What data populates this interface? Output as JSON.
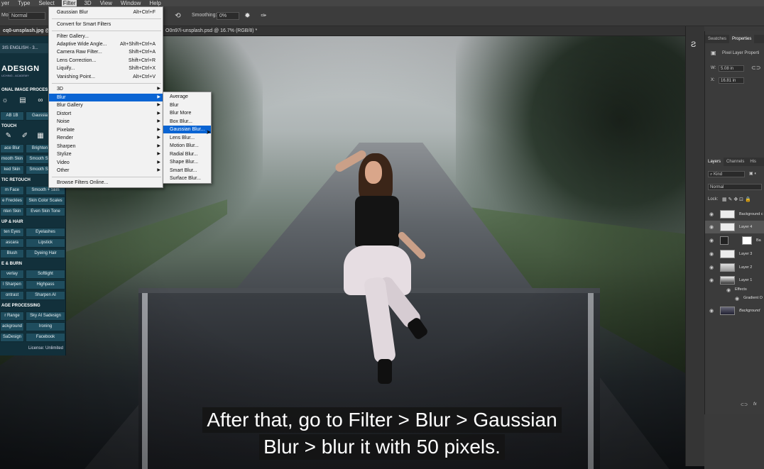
{
  "menubar": {
    "items": [
      "yer",
      "Type",
      "Select",
      "Filter",
      "3D",
      "View",
      "Window",
      "Help"
    ],
    "active": "Filter"
  },
  "options": {
    "mode_label": "Mode:",
    "mode_value": "Normal",
    "smoothing_label": "Smoothing:",
    "smoothing_value": "0%"
  },
  "tabs": {
    "left_doc": "cq0-unsplash.jpg @",
    "right_doc": "O0n97i-unsplash.psd @ 16.7% (RGB/8) *"
  },
  "filter_menu": {
    "top": [
      {
        "label": "Gaussian Blur",
        "shortcut": "Alt+Ctrl+F"
      },
      {
        "label": "Convert for Smart Filters",
        "shortcut": ""
      }
    ],
    "group2": [
      {
        "label": "Filter Gallery...",
        "shortcut": ""
      },
      {
        "label": "Adaptive Wide Angle...",
        "shortcut": "Alt+Shift+Ctrl+A"
      },
      {
        "label": "Camera Raw Filter...",
        "shortcut": "Shift+Ctrl+A"
      },
      {
        "label": "Lens Correction...",
        "shortcut": "Shift+Ctrl+R"
      },
      {
        "label": "Liquify...",
        "shortcut": "Shift+Ctrl+X"
      },
      {
        "label": "Vanishing Point...",
        "shortcut": "Alt+Ctrl+V"
      }
    ],
    "submenus": [
      "3D",
      "Blur",
      "Blur Gallery",
      "Distort",
      "Noise",
      "Pixelate",
      "Render",
      "Sharpen",
      "Stylize",
      "Video",
      "Other"
    ],
    "highlighted": "Blur",
    "browse": "Browse Filters Online..."
  },
  "blur_menu": {
    "items": [
      "Average",
      "Blur",
      "Blur More",
      "Box Blur...",
      "Gaussian Blur...",
      "Lens Blur...",
      "Motion Blur...",
      "Radial Blur...",
      "Shape Blur...",
      "Smart Blur...",
      "Surface Blur..."
    ],
    "highlighted": "Gaussian Blur..."
  },
  "plugin": {
    "tab": "3IS ENGLISH - 3...",
    "brand": "ADESIGN",
    "brand_sub": "UCHING - ACADEMY",
    "sections": {
      "s1": "ONAL IMAGE PROCES",
      "s2": "TOUCH",
      "s3": "TIC RETOUCH",
      "s4": "UP & HAIR",
      "s5": "E & BURN",
      "s6": "AGE PROCESSING"
    },
    "buttons": {
      "b1": "AB 1B",
      "b2": "Gaussia",
      "b3": "ace Blur",
      "b4": "Brighten",
      "b5": "mooth Skin",
      "b6": "Smooth Sk",
      "b7": "ked Skin",
      "b8": "Smooth Sk",
      "b9": "m Face",
      "b10": "Smooth + Slim",
      "b11": "e Freckles",
      "b12": "Skin Color Scales",
      "b13": "nten Skin",
      "b14": "Even Skin Tone",
      "b15": "ten Eyes",
      "b16": "Eyelashes",
      "b17": "ascara",
      "b18": "Lipstick",
      "b19": "Blush",
      "b20": "Dyeing Hair",
      "b21": "verlay",
      "b22": "Softlight",
      "b23": "l Sharpen",
      "b24": "Highpass",
      "b25": "ontrast",
      "b26": "Sharpen AI",
      "b27": "r Range",
      "b28": "Sky AI Sadesign",
      "b29": "ackground",
      "b30": "Ironing",
      "b31": "SaDesign",
      "b32": "Facebook"
    },
    "license": "License: Unlimited"
  },
  "properties": {
    "tab1": "Swatches",
    "tab2": "Properties",
    "type": "Pixel Layer Properti",
    "w_label": "W:",
    "w_value": "5.08 in",
    "x_label": "X:",
    "x_value": "16.81 in"
  },
  "layers": {
    "tab1": "Layers",
    "tab2": "Channels",
    "tab3": "His",
    "kind": "Kind",
    "blend": "Normal",
    "lock_label": "Lock:",
    "items": [
      {
        "name": "Background c"
      },
      {
        "name": "Layer 4"
      },
      {
        "name": "Ba"
      },
      {
        "name": "Layer 3"
      },
      {
        "name": "Layer 2"
      },
      {
        "name": "Layer 1"
      },
      {
        "name": "Effects"
      },
      {
        "name": "Gradient O"
      },
      {
        "name": "Background"
      }
    ],
    "footer": "fx"
  },
  "subtitle": {
    "line1": "After that, go to Filter > Blur > Gaussian",
    "line2": "Blur > blur it with 50 pixels."
  },
  "colors": {
    "menu_highlight": "#0a64d3",
    "plugin_bg": "#12303b",
    "plugin_button": "#1f4d5e"
  }
}
